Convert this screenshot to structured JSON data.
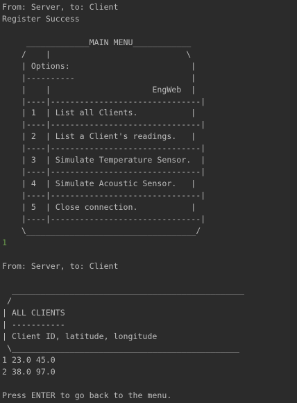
{
  "console": {
    "lines": [
      {
        "text": "From: Server, to: Client",
        "kind": "output"
      },
      {
        "text": "Register Success",
        "kind": "output"
      },
      {
        "text": "",
        "kind": "output"
      },
      {
        "text": "     _____________MAIN MENU____________",
        "kind": "output"
      },
      {
        "text": "    /    |                            \\",
        "kind": "output"
      },
      {
        "text": "    | Options:                         |",
        "kind": "output"
      },
      {
        "text": "    |----------                        |",
        "kind": "output"
      },
      {
        "text": "    |    |                     EngWeb  |",
        "kind": "output"
      },
      {
        "text": "    |----|-------------------------------|",
        "kind": "output"
      },
      {
        "text": "    | 1  | List all Clients.           |",
        "kind": "output"
      },
      {
        "text": "    |----|-------------------------------|",
        "kind": "output"
      },
      {
        "text": "    | 2  | List a Client's readings.   |",
        "kind": "output"
      },
      {
        "text": "    |----|-------------------------------|",
        "kind": "output"
      },
      {
        "text": "    | 3  | Simulate Temperature Sensor.  |",
        "kind": "output"
      },
      {
        "text": "    |----|-------------------------------|",
        "kind": "output"
      },
      {
        "text": "    | 4  | Simulate Acoustic Sensor.   |",
        "kind": "output"
      },
      {
        "text": "    |----|-------------------------------|",
        "kind": "output"
      },
      {
        "text": "    | 5  | Close connection.           |",
        "kind": "output"
      },
      {
        "text": "    |----|-------------------------------|",
        "kind": "output"
      },
      {
        "text": "    \\___________________________________/",
        "kind": "output"
      },
      {
        "text": "1",
        "kind": "input"
      },
      {
        "text": "",
        "kind": "output"
      },
      {
        "text": "From: Server, to: Client",
        "kind": "output"
      },
      {
        "text": "",
        "kind": "output"
      },
      {
        "text": "  ________________________________________________",
        "kind": "output"
      },
      {
        "text": " /",
        "kind": "output"
      },
      {
        "text": "| ALL CLIENTS",
        "kind": "output"
      },
      {
        "text": "| -----------",
        "kind": "output"
      },
      {
        "text": "| Client ID, latitude, longitude",
        "kind": "output"
      },
      {
        "text": " \\_______________________________________________",
        "kind": "output"
      },
      {
        "text": "1 23.0 45.0",
        "kind": "output"
      },
      {
        "text": "2 38.0 97.0",
        "kind": "output"
      },
      {
        "text": "",
        "kind": "output"
      },
      {
        "text": "Press ENTER to go back to the menu.",
        "kind": "output"
      }
    ]
  },
  "colors": {
    "background": "#2b2b2b",
    "output_text": "#bbbbbb",
    "input_text": "#6a9a4c"
  }
}
